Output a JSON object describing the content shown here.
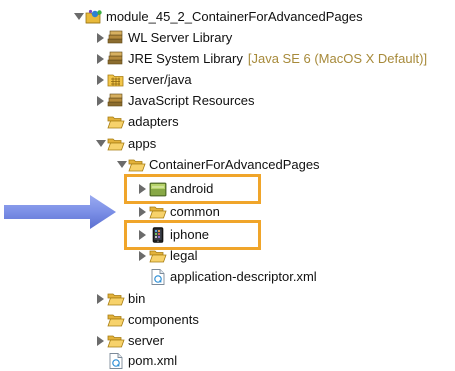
{
  "tree": {
    "project": {
      "label": "module_45_2_ContainerForAdvancedPages",
      "icon": "eclipse-project-icon",
      "expanded": true
    },
    "items": [
      {
        "label": "WL Server Library",
        "icon": "library-icon",
        "expanded": false
      },
      {
        "label": "JRE System Library",
        "decoration": "[Java SE 6 (MacOS X Default)]",
        "icon": "library-icon",
        "expanded": false
      },
      {
        "label": "server/java",
        "icon": "source-folder-icon",
        "expanded": false
      },
      {
        "label": "JavaScript Resources",
        "icon": "library-icon",
        "expanded": false
      },
      {
        "label": "adapters",
        "icon": "folder-icon"
      },
      {
        "label": "apps",
        "icon": "folder-open-icon",
        "expanded": true
      },
      {
        "label": "ContainerForAdvancedPages",
        "icon": "folder-open-icon",
        "expanded": true
      },
      {
        "label": "android",
        "icon": "android-folder-icon",
        "expanded": false,
        "highlighted": true
      },
      {
        "label": "common",
        "icon": "folder-icon",
        "expanded": false
      },
      {
        "label": "iphone",
        "icon": "iphone-folder-icon",
        "expanded": false,
        "highlighted": true
      },
      {
        "label": "legal",
        "icon": "folder-icon",
        "expanded": false
      },
      {
        "label": "application-descriptor.xml",
        "icon": "xml-file-icon"
      },
      {
        "label": "bin",
        "icon": "folder-icon",
        "expanded": false
      },
      {
        "label": "components",
        "icon": "folder-icon"
      },
      {
        "label": "server",
        "icon": "folder-icon",
        "expanded": false
      },
      {
        "label": "pom.xml",
        "icon": "xml-file-icon"
      }
    ]
  },
  "colors": {
    "highlight_border": "#f0a52a",
    "arrow_fill": "#7b8fe6",
    "decoration_text": "#a78a3a",
    "folder_yellow": "#f3c64a"
  }
}
